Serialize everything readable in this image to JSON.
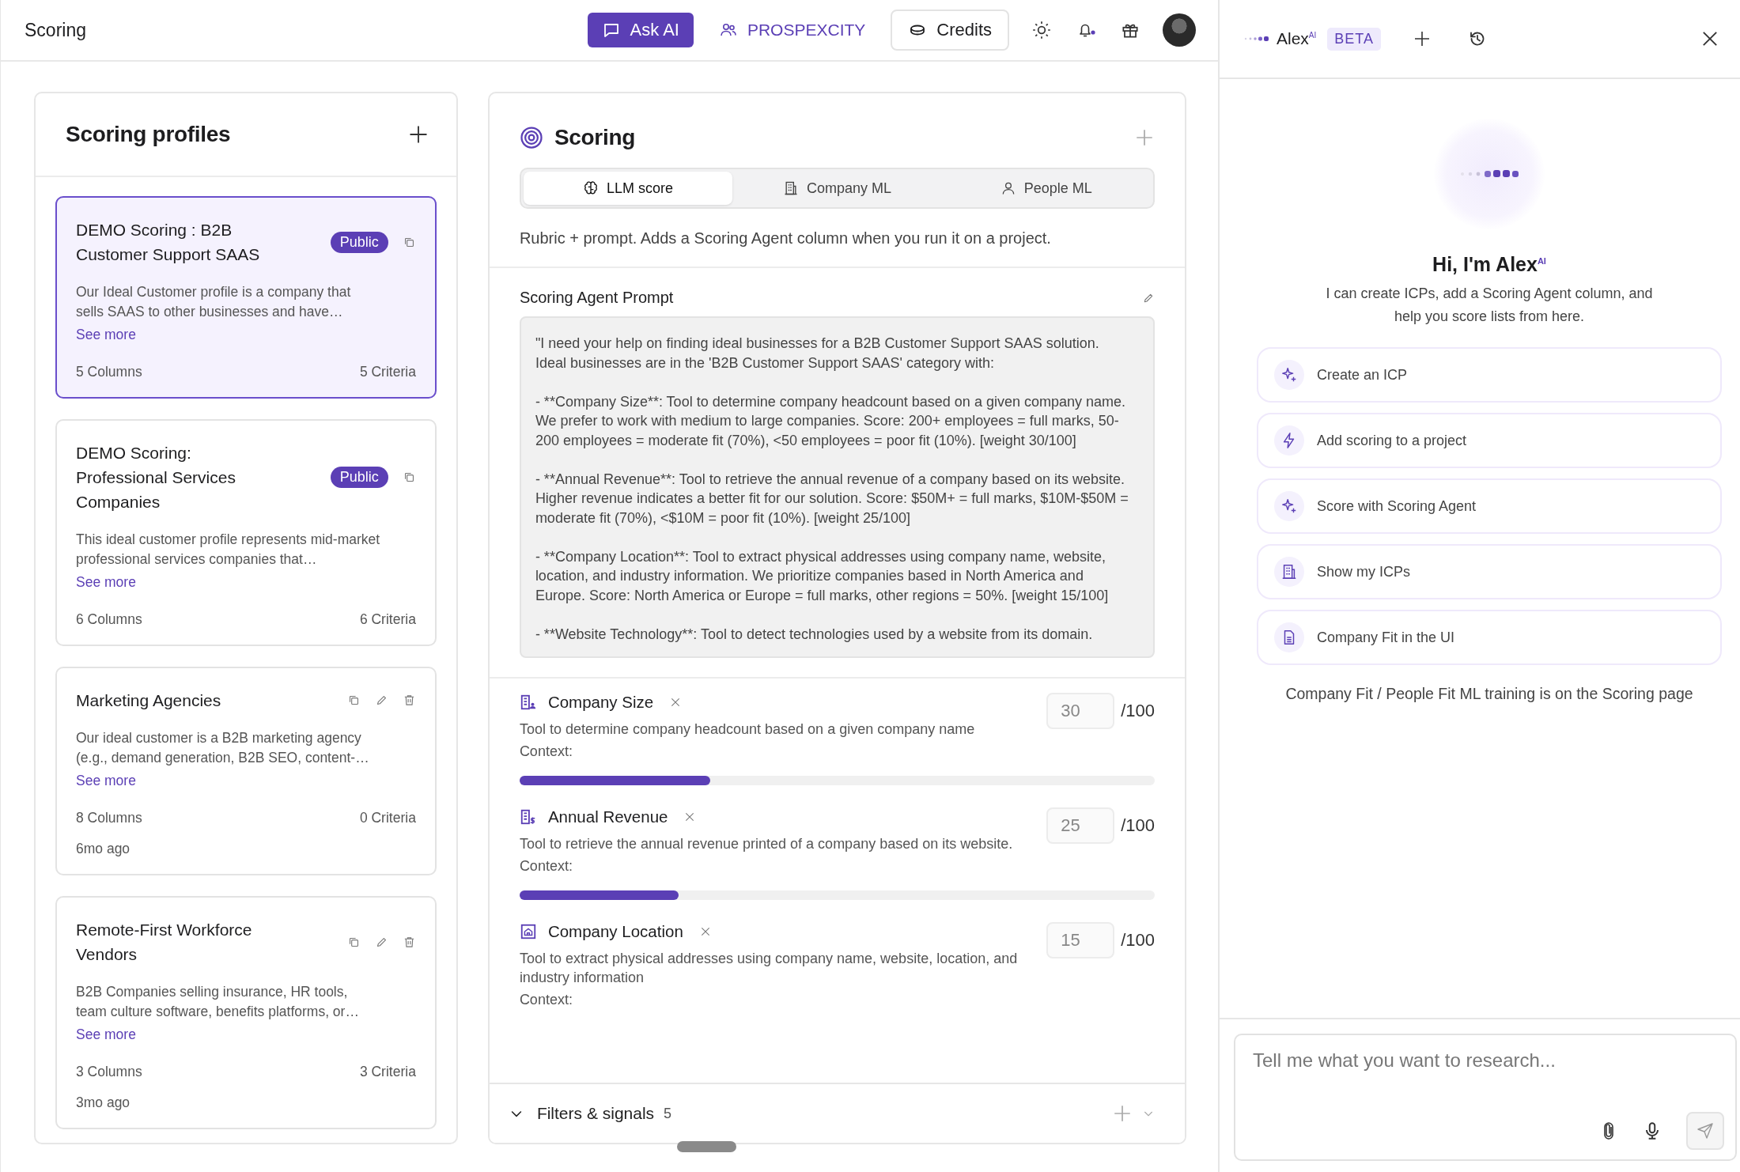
{
  "header": {
    "title": "Scoring",
    "ask_ai": "Ask AI",
    "workspace": "PROSPEXCITY",
    "credits": "Credits"
  },
  "profiles": {
    "title": "Scoring profiles",
    "items": [
      {
        "kind": "public",
        "selected": true,
        "title": "DEMO Scoring : B2B Customer Support SAAS",
        "badge": "Public",
        "description": "Our Ideal Customer profile is a company that sells SAAS to other businesses and have…",
        "link": "See more",
        "columns": "5 Columns",
        "criteria": "5 Criteria"
      },
      {
        "kind": "public",
        "selected": false,
        "title": "DEMO Scoring: Professional Services Companies",
        "badge": "Public",
        "description": "This ideal customer profile represents mid-market professional services companies that…",
        "link": "See more",
        "columns": "6 Columns",
        "criteria": "6 Criteria"
      },
      {
        "kind": "own",
        "selected": false,
        "title": "Marketing Agencies",
        "description": "Our ideal customer is a B2B marketing agency (e.g., demand generation, B2B SEO, content-…",
        "link": "See more",
        "columns": "8 Columns",
        "criteria": "0 Criteria",
        "age": "6mo ago"
      },
      {
        "kind": "own",
        "selected": false,
        "title": "Remote-First Workforce Vendors",
        "description": "B2B Companies selling insurance, HR tools, team culture software, benefits platforms, or…",
        "link": "See more",
        "columns": "3 Columns",
        "criteria": "3 Criteria",
        "age": "3mo ago"
      }
    ]
  },
  "scoring": {
    "title": "Scoring",
    "tabs": [
      {
        "label": "LLM score",
        "selected": true
      },
      {
        "label": "Company ML",
        "selected": false
      },
      {
        "label": "People ML",
        "selected": false
      }
    ],
    "description": "Rubric + prompt. Adds a Scoring Agent column when you run it on a project.",
    "prompt": {
      "title": "Scoring Agent Prompt",
      "text": "\"I need your help on finding ideal businesses for a B2B Customer Support SAAS solution. Ideal businesses are in the 'B2B Customer Support SAAS' category with:\n\n- **Company Size**: Tool to determine company headcount based on a given company name. We prefer to work with medium to large companies. Score: 200+ employees = full marks, 50-200 employees = moderate fit (70%), <50 employees = poor fit (10%). [weight 30/100]\n\n- **Annual Revenue**: Tool to retrieve the annual revenue of a company based on its website. Higher revenue indicates a better fit for our solution. Score: $50M+ = full marks, $10M-$50M = moderate fit (70%), <$10M = poor fit (10%). [weight 25/100]\n\n- **Company Location**: Tool to extract physical addresses using company name, website, location, and industry information. We prioritize companies based in North America and Europe. Score: North America or Europe = full marks, other regions = 50%. [weight 15/100]\n\n- **Website Technology**: Tool to detect technologies used by a website from its domain."
    },
    "criteria": [
      {
        "name": "Company Size",
        "description": "Tool to determine company headcount based on a given company name",
        "context": "Context:",
        "weight": "30",
        "max": "/100",
        "level": 0.3
      },
      {
        "name": "Annual Revenue",
        "description": "Tool to retrieve the annual revenue printed of a company based on its website.",
        "context": "Context:",
        "weight": "25",
        "max": "/100",
        "level": 0.25
      },
      {
        "name": "Company Location",
        "description": "Tool to extract physical addresses using company name, website, location, and industry information",
        "context": "Context:",
        "weight": "15",
        "max": "/100"
      }
    ],
    "footer": {
      "label": "Filters & signals",
      "count": "5"
    }
  },
  "assistant": {
    "name": "Alex$^{AI}$",
    "badge": "BETA",
    "greeting": "Hi, I'm Alex$^{AI}$",
    "intro": "I can create ICPs, add a Scoring Agent column, and help you score lists from here.",
    "suggestions": [
      "Create an ICP",
      "Add scoring to a project",
      "Score with Scoring Agent",
      "Show my ICPs",
      "Company Fit in the UI"
    ],
    "note": "Company Fit / People Fit ML training is on the Scoring page",
    "input": {
      "placeholder": "Tell me what you want to research..."
    }
  }
}
